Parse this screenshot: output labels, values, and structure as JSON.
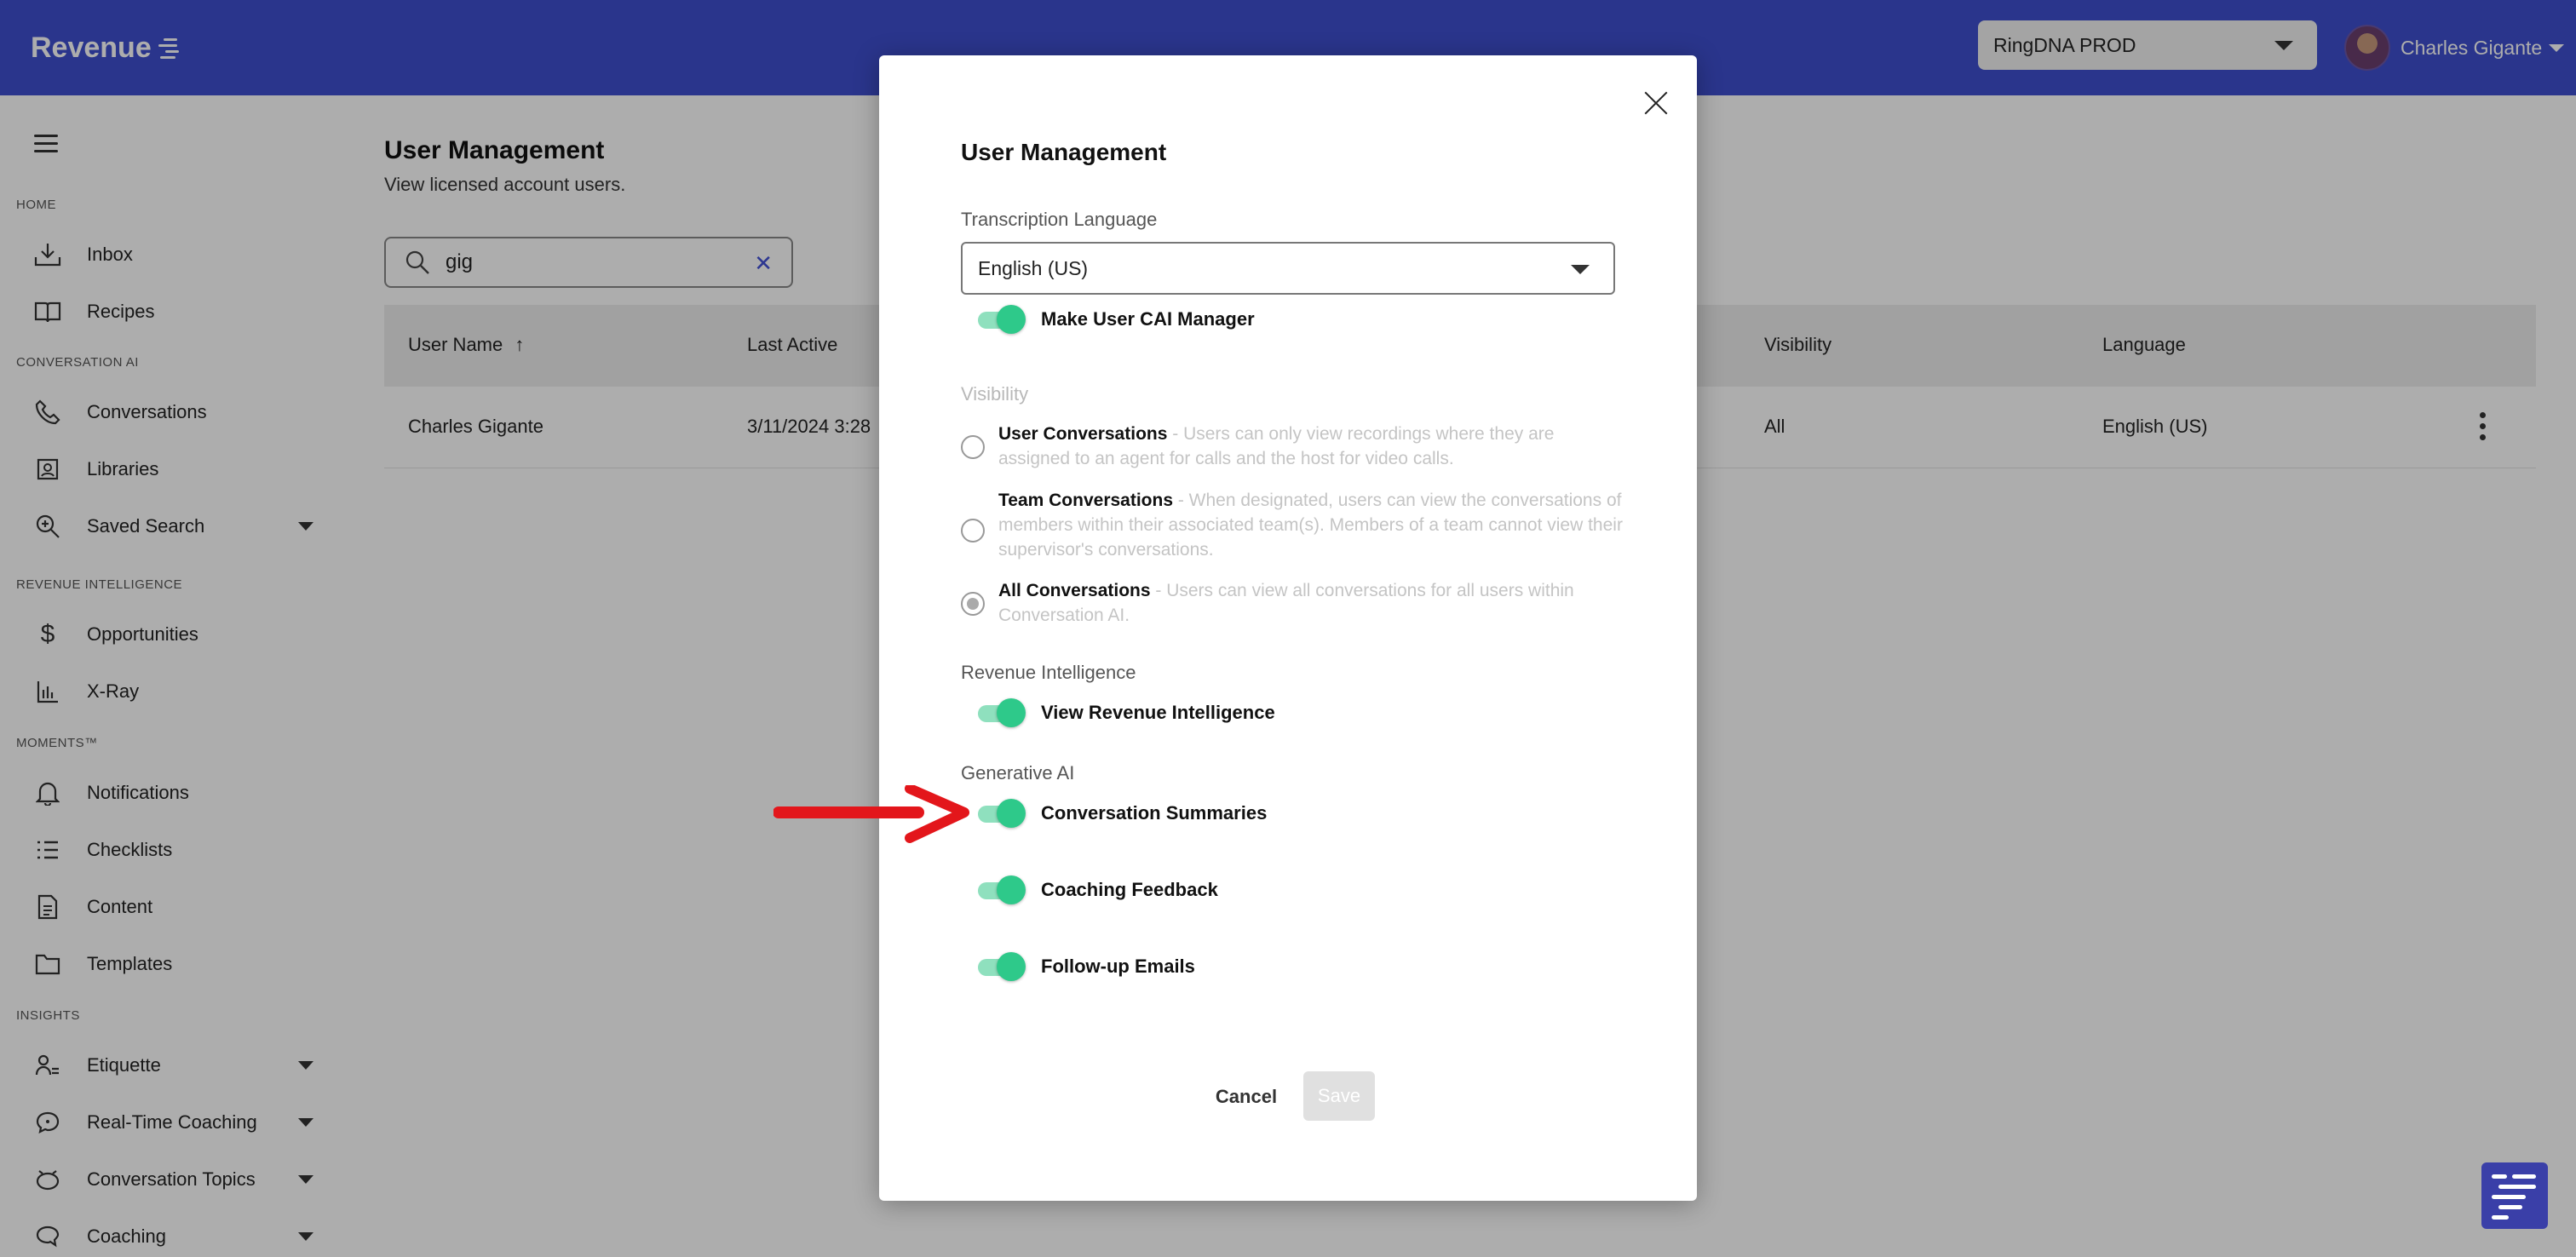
{
  "header": {
    "brand": "Revenue",
    "account_select": "RingDNA PROD",
    "user_name": "Charles Gigante"
  },
  "sidebar": {
    "sections": {
      "home": "HOME",
      "conversation_ai": "CONVERSATION AI",
      "revenue_intelligence": "REVENUE INTELLIGENCE",
      "moments": "MOMENTS™",
      "insights": "INSIGHTS"
    },
    "items": [
      {
        "label": "Inbox",
        "icon": "inbox-icon"
      },
      {
        "label": "Recipes",
        "icon": "book-icon"
      },
      {
        "label": "Conversations",
        "icon": "phone-icon"
      },
      {
        "label": "Libraries",
        "icon": "library-icon"
      },
      {
        "label": "Saved Search",
        "icon": "zoom-in-icon"
      },
      {
        "label": "Opportunities",
        "icon": "dollar-icon"
      },
      {
        "label": "X-Ray",
        "icon": "bar-chart-icon"
      },
      {
        "label": "Notifications",
        "icon": "bell-icon"
      },
      {
        "label": "Checklists",
        "icon": "checklist-icon"
      },
      {
        "label": "Content",
        "icon": "document-icon"
      },
      {
        "label": "Templates",
        "icon": "folder-icon"
      },
      {
        "label": "Etiquette",
        "icon": "user-lines-icon"
      },
      {
        "label": "Real-Time Coaching",
        "icon": "chat-bubble-icon"
      },
      {
        "label": "Conversation Topics",
        "icon": "alarm-icon"
      },
      {
        "label": "Coaching",
        "icon": "speech-icon"
      }
    ]
  },
  "main": {
    "title": "User Management",
    "subtitle": "View licensed account users.",
    "search_value": "gig",
    "table": {
      "headers": {
        "user_name": "User Name",
        "last_active": "Last Active",
        "visibility": "Visibility",
        "language": "Language"
      },
      "rows": [
        {
          "user_name": "Charles Gigante",
          "last_active": "3/11/2024 3:28",
          "visibility": "All",
          "language": "English (US)"
        }
      ]
    }
  },
  "modal": {
    "title": "User Management",
    "transcription_label": "Transcription Language",
    "language_value": "English (US)",
    "cai_manager_label": "Make User CAI Manager",
    "visibility_label": "Visibility",
    "visibility_options": [
      {
        "title": "User Conversations",
        "desc": " - Users can only view recordings where they are assigned to an agent for calls and the host for video calls.",
        "checked": false
      },
      {
        "title": "Team Conversations",
        "desc": " - When designated, users can view the conversations of members within their associated team(s). Members of a team cannot view their supervisor's conversations.",
        "checked": false
      },
      {
        "title": "All Conversations",
        "desc": " - Users can view all conversations for all users within Conversation AI.",
        "checked": true
      }
    ],
    "revenue_intelligence_label": "Revenue Intelligence",
    "view_ri_label": "View Revenue Intelligence",
    "generative_ai_label": "Generative AI",
    "conversation_summaries_label": "Conversation Summaries",
    "coaching_feedback_label": "Coaching Feedback",
    "followup_emails_label": "Follow-up Emails",
    "cancel_label": "Cancel",
    "save_label": "Save"
  },
  "colors": {
    "topbar": "#3f4fce",
    "toggle_on": "#2ec98a",
    "annotation_arrow": "#e3161b"
  }
}
